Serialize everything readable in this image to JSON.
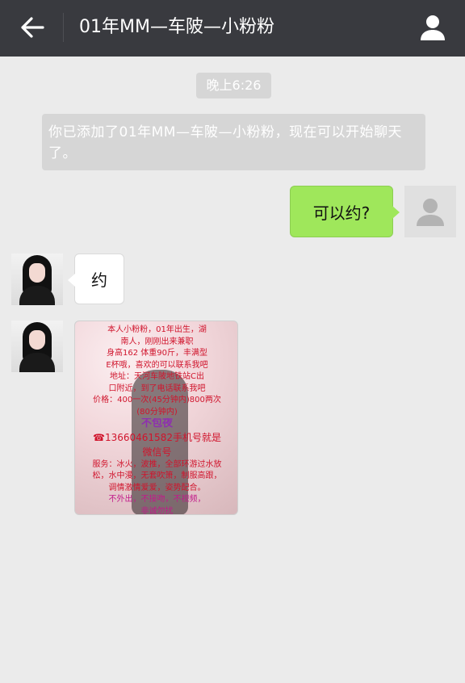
{
  "header": {
    "back_icon": "arrow-left-icon",
    "title": "01年MM—车陂—小粉粉",
    "profile_icon": "person-icon"
  },
  "chat": {
    "timestamp": "晚上6:26",
    "system_message": "你已添加了01年MM—车陂—小粉粉，现在可以开始聊天了。",
    "outgoing_message": "可以约?",
    "incoming_message": "约",
    "image_message_lines": [
      "本人小粉粉，01年出生，湖",
      "南人，刚刚出来兼职",
      "身高162 体重90斤，丰满型",
      "E杯哦，喜欢的可以联系我吧",
      "地址：天河车陂地铁站C出",
      "口附近，到了电话联系我吧",
      "价格：400一次(45分钟内)800两次",
      "(80分钟内)",
      "不包夜",
      "☎13660461582手机号就是",
      "微信号",
      "服务：冰火，波推，全部环游过水放",
      "松，水中漫，无套吹箫，制服高跟，",
      "调情激情爱爱，姿势配合。",
      "不外出，不接吻，不视频，",
      "非诚勿扰"
    ]
  },
  "colors": {
    "topbar": "#393a3f",
    "background": "#ebebeb",
    "outgoing_bubble": "#9fe75b",
    "incoming_bubble": "#ffffff",
    "system_bubble": "#d6d6d6"
  }
}
